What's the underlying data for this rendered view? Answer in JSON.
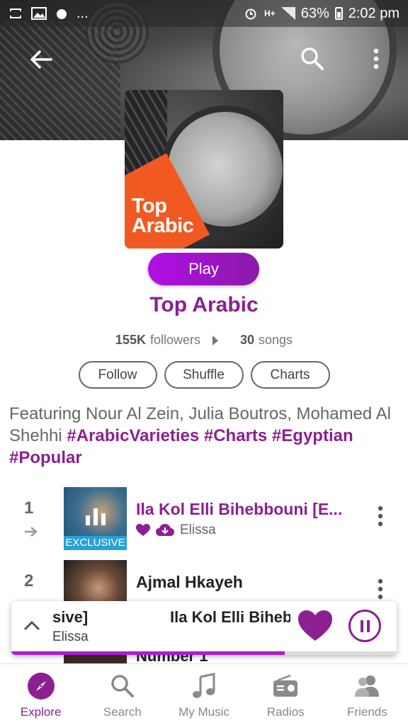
{
  "status_bar": {
    "battery": "63%",
    "time": "2:02 pm",
    "network": "H+",
    "notifications_more": "..."
  },
  "playlist": {
    "cover_title": "Top\nArabic",
    "play_label": "Play",
    "title": "Top Arabic",
    "followers_count": "155K",
    "followers_label": "followers",
    "songs_count": "30",
    "songs_label": "songs",
    "follow_label": "Follow",
    "shuffle_label": "Shuffle",
    "charts_label": "Charts",
    "description_prefix": "Featuring Nour Al Zein, Julia Boutros, Mohamed Al Shehhi",
    "tags": [
      "#ArabicVarieties",
      "#Charts",
      "#Egyptian",
      "#Popular"
    ]
  },
  "tracks": [
    {
      "rank": "1",
      "title": "Ila Kol Elli Bihebbouni [E...",
      "artist": "Elissa",
      "badge": "EXCLUSIVE",
      "liked": true,
      "downloaded": true
    },
    {
      "rank": "2",
      "title": "Ajmal Hkayeh",
      "artist": ""
    }
  ],
  "peek_track_title": "Number 1",
  "mini_player": {
    "ticker_part1": "sive]",
    "ticker_part2": "Ila Kol Elli Bihebbouni",
    "artist": "Elissa",
    "progress": 0.71
  },
  "bottom_nav": [
    {
      "label": "Explore",
      "icon": "compass-icon",
      "active": true
    },
    {
      "label": "Search",
      "icon": "search-icon"
    },
    {
      "label": "My Music",
      "icon": "music-note-icon"
    },
    {
      "label": "Radios",
      "icon": "radio-icon"
    },
    {
      "label": "Friends",
      "icon": "friends-icon"
    }
  ],
  "colors": {
    "accent": "#8c1f92",
    "play_gradient_start": "#b10ee6",
    "exclusive_badge": "#2aa0d8",
    "cover_orange": "#f05a22"
  }
}
